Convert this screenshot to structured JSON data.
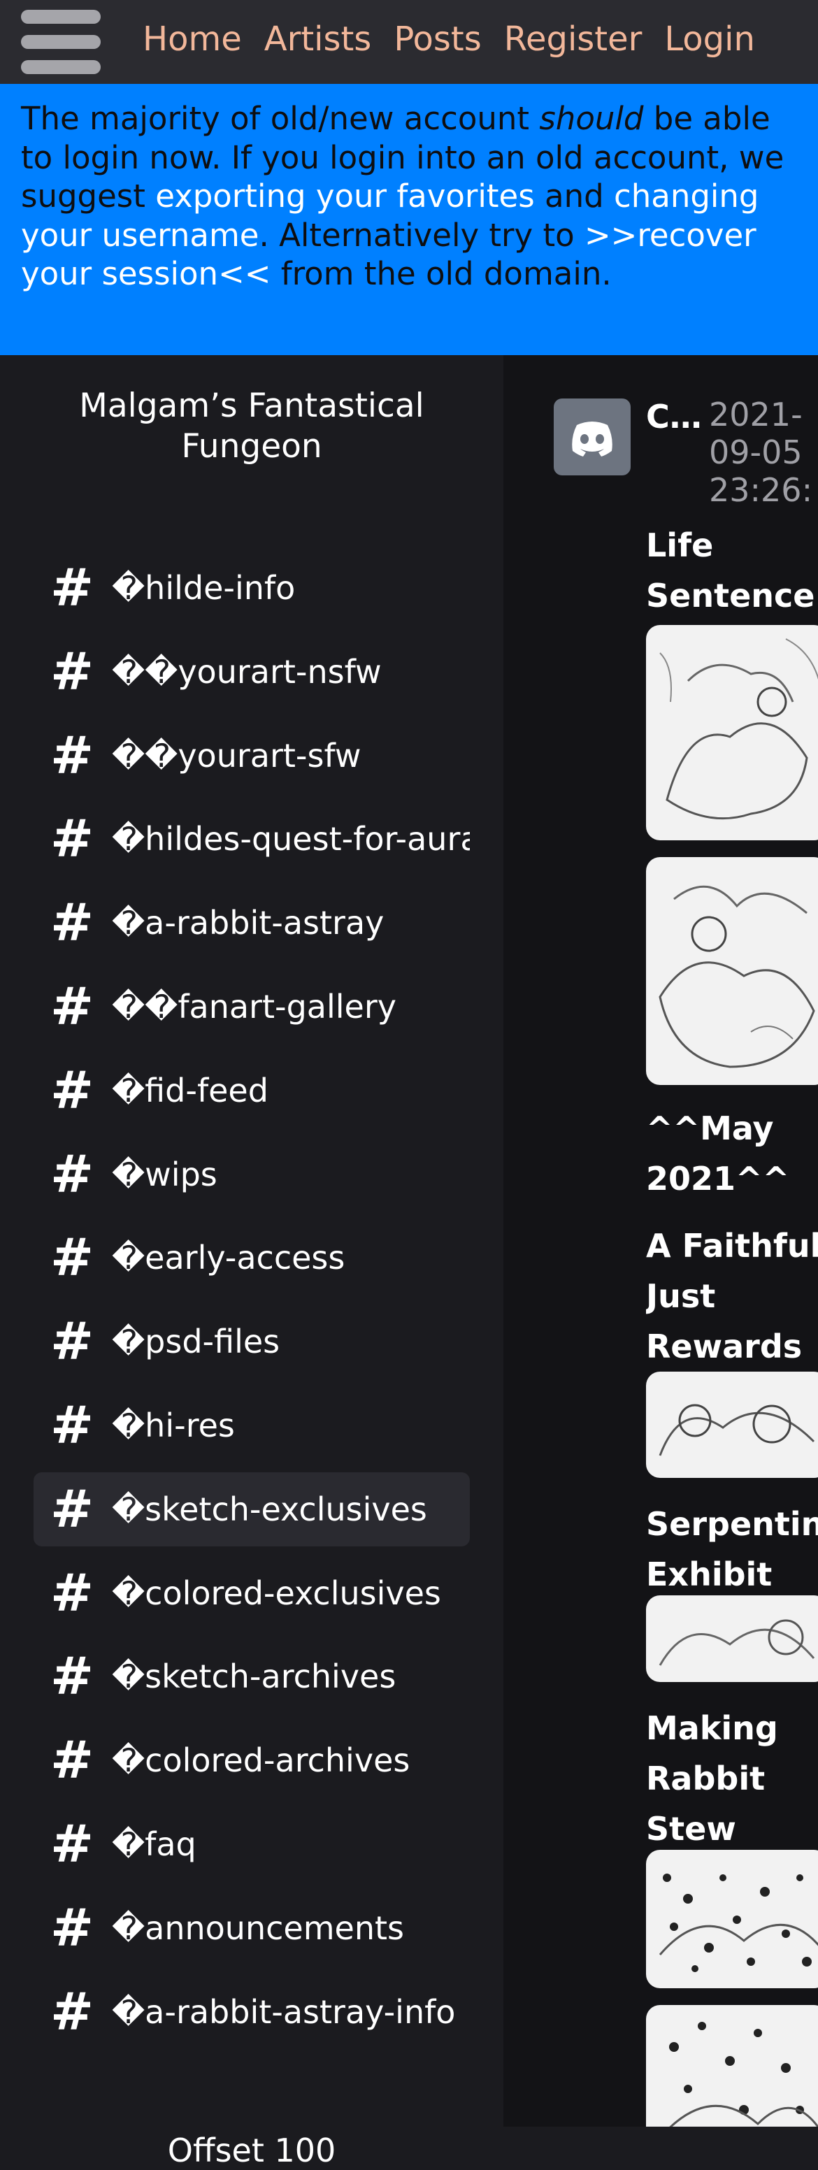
{
  "nav": {
    "menu_icon": "hamburger-menu-icon",
    "links": [
      "Home",
      "Artists",
      "Posts",
      "Register",
      "Login"
    ]
  },
  "notice": {
    "t1": "The majority of old/new account ",
    "t2": "should",
    "t3": " be able to login now. If you login into an old account, we suggest ",
    "link1": "exporting your favorites",
    "t4": " and ",
    "link2": "changing your username",
    "t5": ". Alternatively try to ",
    "link3": ">>recover your session<<",
    "t6": " from the old domain."
  },
  "sidebar": {
    "server_name": "Malgam’s Fantastical Fungeon",
    "channel_icon": "hash-icon",
    "channels": [
      {
        "label": "�hilde-info"
      },
      {
        "label": "��yourart-nsfw"
      },
      {
        "label": "��yourart-sfw"
      },
      {
        "label": "�hildes-quest-for-aura"
      },
      {
        "label": "�a-rabbit-astray"
      },
      {
        "label": "��fanart-gallery"
      },
      {
        "label": "�fid-feed"
      },
      {
        "label": "�wips"
      },
      {
        "label": "�early-access"
      },
      {
        "label": "�psd-files"
      },
      {
        "label": "�hi-res"
      },
      {
        "label": "�sketch-exclusives",
        "active": true
      },
      {
        "label": "�colored-exclusives"
      },
      {
        "label": "�sketch-archives"
      },
      {
        "label": "�colored-archives"
      },
      {
        "label": "�faq"
      },
      {
        "label": "�announcements"
      },
      {
        "label": "�a-rabbit-astray-info"
      }
    ],
    "offset_label": "Offset 100"
  },
  "message": {
    "avatar_icon": "discord-logo-icon",
    "author": "C…",
    "timestamp": "2021-\n09-05\n23:26:",
    "titles": [
      "Life\nSentence",
      "^^May\n2021^^",
      "A Faithful\nJust\nRewards",
      "Serpentine\nExhibit",
      "Making\nRabbit\nStew"
    ]
  },
  "colors": {
    "background": "#1b1b1f",
    "navbar": "#2b2b30",
    "nav_link": "#f2b79a",
    "notice_bg": "#0080ff",
    "active_channel": "#2a2a30"
  }
}
